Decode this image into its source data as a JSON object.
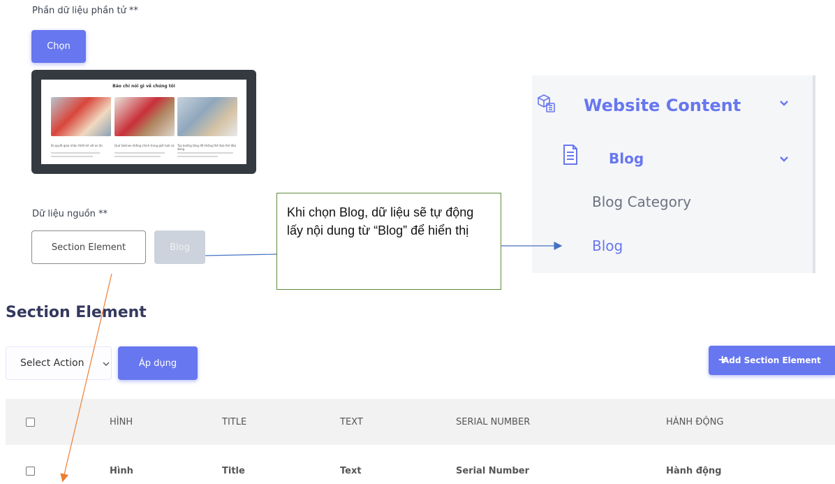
{
  "form": {
    "element_data_label": "Phần dữ liệu phần tử **",
    "choose_button": "Chọn",
    "preview": {
      "title": "Báo chí nói gì về chúng tôi",
      "captions": [
        "Bí quyết giao nhận thiết kế với an ẩn",
        "Quá Satinex khẳng chính trong giới tươi và",
        "Tuỳ bướng tăng để không thể đưa thẻ đảo đang"
      ]
    },
    "source_label": "Dữ liệu nguồn **",
    "source_buttons": [
      "Section Element",
      "Blog"
    ]
  },
  "callout": {
    "text": "Khi chọn Blog, dữ liệu sẽ tự động lấy nội dung từ “Blog” để hiển thị"
  },
  "sidebar": {
    "website_content": "Website Content",
    "blog": "Blog",
    "blog_category": "Blog Category",
    "blog_item": "Blog",
    "icons": [
      "boxes-icon",
      "document-icon",
      "chevron-down-icon"
    ]
  },
  "section": {
    "title": "Section Element",
    "select_action": "Select Action",
    "apply_button": "Áp dụng",
    "add_button": "Add Section Element",
    "headers": [
      "HÌNH",
      "TITLE",
      "TEXT",
      "SERIAL NUMBER",
      "HÀNH ĐỘNG"
    ],
    "row": [
      "Hình",
      "Title",
      "Text",
      "Serial Number",
      "Hành động"
    ]
  },
  "colors": {
    "primary": "#6777ef",
    "callout_border": "#5e8a3a",
    "arrow_blue": "#4472c4",
    "arrow_orange": "#ed7d31",
    "preview_frame": "#343a40"
  }
}
